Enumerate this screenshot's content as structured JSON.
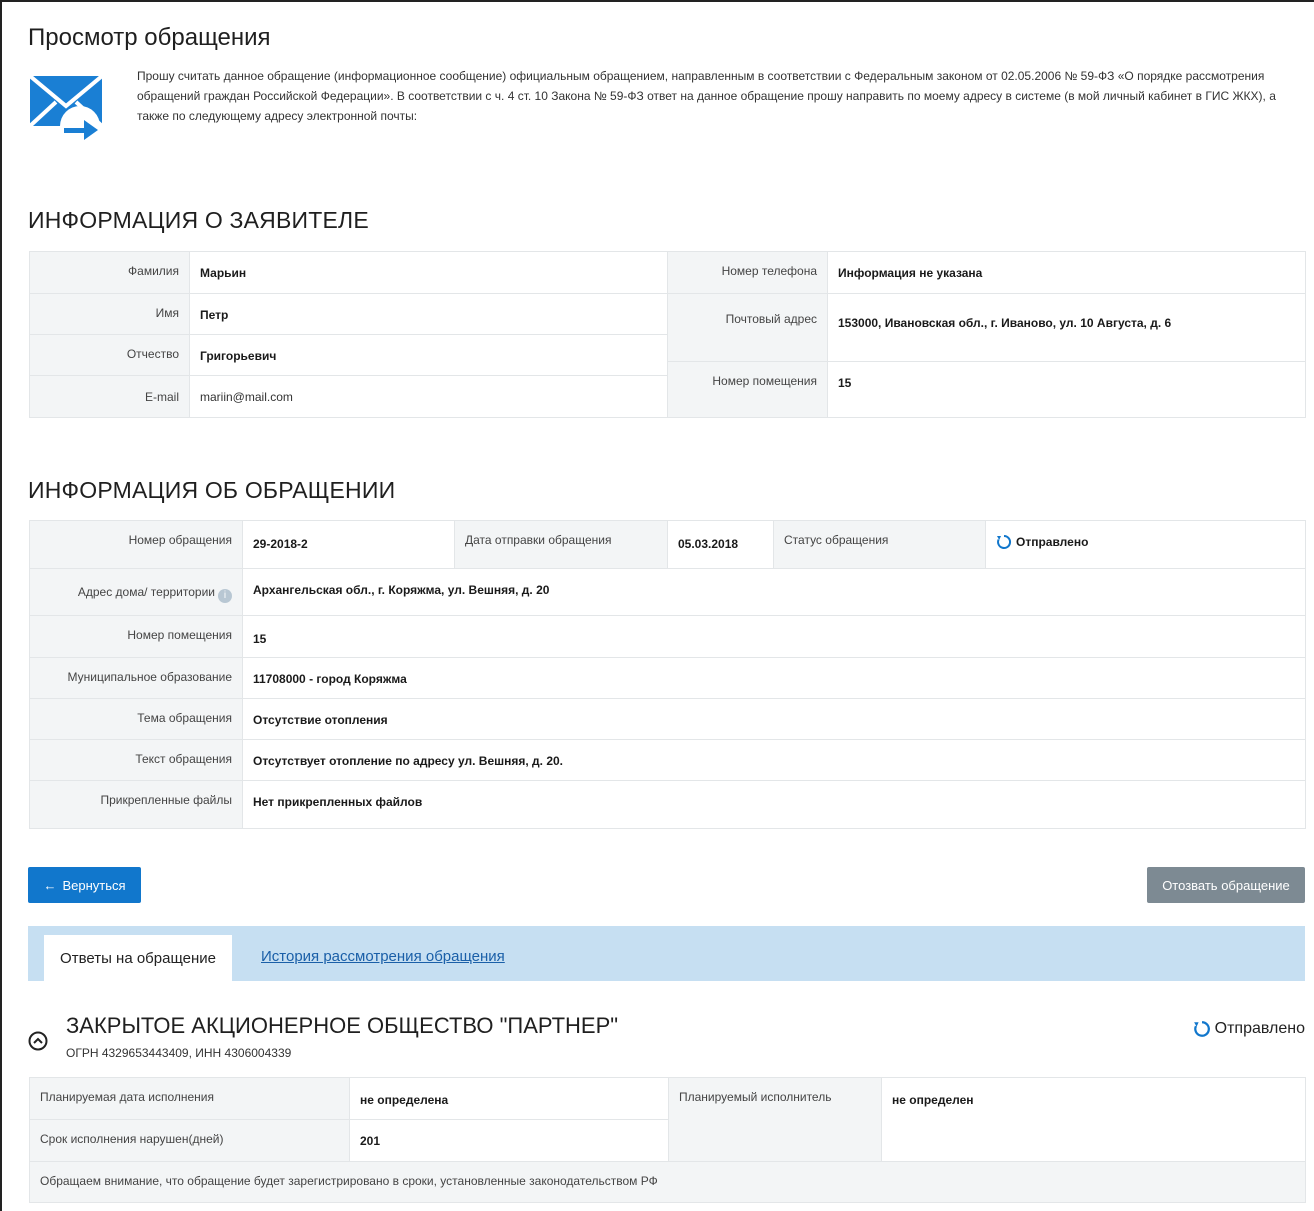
{
  "page": {
    "title": "Просмотр обращения",
    "intro": "Прошу считать данное обращение (информационное сообщение) официальным обращением, направленным в соответствии с Федеральным законом от 02.05.2006 № 59-ФЗ «О порядке рассмотрения обращений граждан Российской Федерации». В соответствии с ч. 4 ст. 10 Закона № 59-ФЗ ответ на данное обращение прошу направить по моему адресу в системе (в мой личный кабинет в ГИС ЖКХ), а также по следующему адресу электронной почты:"
  },
  "applicant": {
    "section_title": "ИНФОРМАЦИЯ О ЗАЯВИТЕЛЕ",
    "surname_label": "Фамилия",
    "surname": "Марьин",
    "name_label": "Имя",
    "name": "Петр",
    "patronymic_label": "Отчество",
    "patronymic": "Григорьевич",
    "email_label": "E-mail",
    "email": "mariin@mail.com",
    "phone_label": "Номер телефона",
    "phone": "Информация не указана",
    "postal_label": "Почтовый адрес",
    "postal": "153000, Ивановская обл., г. Иваново, ул. 10 Августа, д. 6",
    "room_label": "Номер помещения",
    "room": "15"
  },
  "appeal": {
    "section_title": "ИНФОРМАЦИЯ ОБ ОБРАЩЕНИИ",
    "number_label": "Номер обращения",
    "number": "29-2018-2",
    "date_label": "Дата отправки обращения",
    "date": "05.03.2018",
    "status_label": "Статус обращения",
    "status": "Отправлено",
    "address_label": "Адрес дома/ территории",
    "address": "Архангельская обл., г. Коряжма, ул. Вешняя, д. 20",
    "room_label": "Номер помещения",
    "room": "15",
    "municipality_label": "Муниципальное образование",
    "municipality": "11708000 - город Коряжма",
    "topic_label": "Тема обращения",
    "topic": "Отсутствие отопления",
    "text_label": "Текст обращения",
    "text": "Отсутствует отопление по адресу ул. Вешняя, д. 20.",
    "files_label": "Прикрепленные файлы",
    "files": "Нет прикрепленных файлов"
  },
  "buttons": {
    "back": "Вернуться",
    "revoke": "Отозвать обращение"
  },
  "tabs": {
    "answers": "Ответы на обращение",
    "history": "История рассмотрения обращения"
  },
  "organization": {
    "name": "ЗАКРЫТОЕ АКЦИОНЕРНОЕ ОБЩЕСТВО \"ПАРТНЕР\"",
    "ids": "ОГРН 4329653443409, ИНН 4306004339",
    "status": "Отправлено",
    "planned_date_label": "Планируемая дата исполнения",
    "planned_date": "не определена",
    "overdue_label": "Срок исполнения нарушен(дней)",
    "overdue": "201",
    "executor_label": "Планируемый исполнитель",
    "executor": "не определен",
    "notice": "Обращаем внимание, что обращение будет зарегистрировано в сроки, установленные законодательством РФ"
  },
  "colors": {
    "primary": "#1177cc",
    "revoke_button": "#7d8a93",
    "tabbar": "#c6dff2",
    "overdue": "#b03a1e"
  }
}
